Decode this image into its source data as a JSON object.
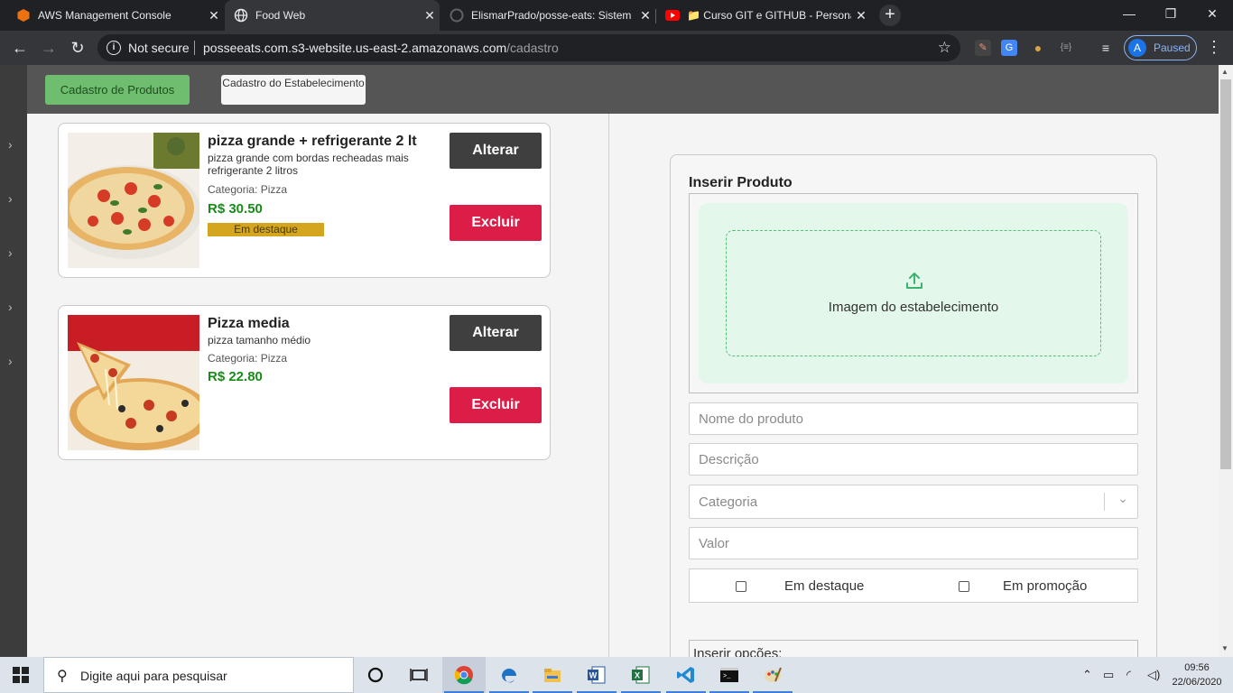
{
  "browser": {
    "tabs": [
      {
        "title": "AWS Management Console",
        "icon": "aws-icon"
      },
      {
        "title": "Food Web",
        "icon": "globe-icon"
      },
      {
        "title": "ElismarPrado/posse-eats: Sistem",
        "icon": "github-icon"
      },
      {
        "title": "📁 Curso GIT e GITHUB - Persona",
        "icon": "youtube-icon"
      }
    ],
    "security_label": "Not secure",
    "url_host": "posseeats.com.s3-website.us-east-2.amazonaws.com",
    "url_path": "/cadastro",
    "profile_initial": "A",
    "profile_status": "Paused"
  },
  "topnav": {
    "cadastro_produtos": "Cadastro de Produtos",
    "cadastro_estabelecimento": "Cadastro do Estabelecimento"
  },
  "products": [
    {
      "name": "pizza grande + refrigerante 2 lt",
      "description": "pizza grande com bordas recheadas mais refrigerante 2 litros",
      "category": "Categoria: Pizza",
      "price": "R$ 30.50",
      "badge": "Em destaque",
      "alter_label": "Alterar",
      "delete_label": "Excluir"
    },
    {
      "name": "Pizza media",
      "description": "pizza tamanho médio",
      "category": "Categoria: Pizza",
      "price": "R$ 22.80",
      "alter_label": "Alterar",
      "delete_label": "Excluir"
    }
  ],
  "form": {
    "title": "Inserir Produto",
    "image_label": "Imagem do estabelecimento",
    "name_placeholder": "Nome do produto",
    "description_placeholder": "Descrição",
    "category_placeholder": "Categoria",
    "price_placeholder": "Valor",
    "highlight_label": "Em destaque",
    "promo_label": "Em promoção",
    "options_label": "Inserir opções:"
  },
  "taskbar": {
    "search_placeholder": "Digite aqui para pesquisar",
    "time": "09:56",
    "date": "22/06/2020"
  },
  "colors": {
    "accent_green": "#6fbe6f",
    "delete_red": "#dc1d48",
    "price_green": "#1b8a1b",
    "badge_gold": "#d4a51f"
  }
}
